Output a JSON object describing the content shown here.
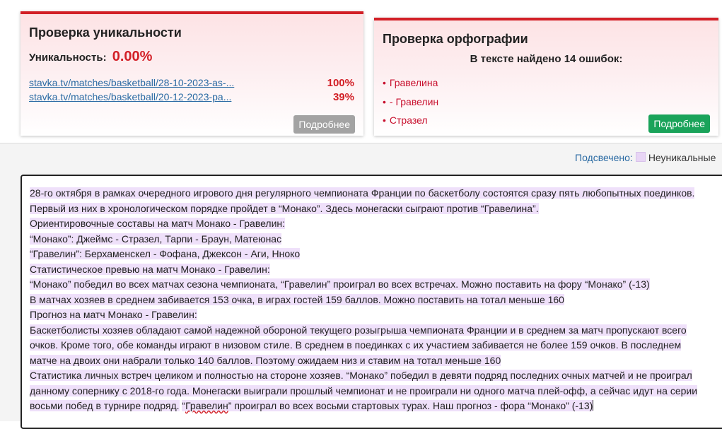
{
  "uniqueness_card": {
    "title": "Проверка уникальности",
    "uniqueness_label": "Уникальность:",
    "uniqueness_value": "0.00%",
    "sources": [
      {
        "url": "stavka.tv/matches/basketball/28-10-2023-as-...",
        "percent": "100%"
      },
      {
        "url": "stavka.tv/matches/basketball/20-12-2023-pa...",
        "percent": "39%"
      }
    ],
    "more_button": "Подробнее"
  },
  "spelling_card": {
    "title": "Проверка орфографии",
    "errors_found": "В тексте найдено 14 ошибок:",
    "errors": [
      "Гравелина",
      "- Гравелин",
      "Стразел"
    ],
    "bullet": "•",
    "more_button": "Подробнее"
  },
  "legend": {
    "label": "Подсвечено:",
    "item": "Неуникальные"
  },
  "editor": {
    "lines": [
      "28-го октября в рамках очередного игрового дня регулярного чемпионата Франции по баскетболу состоятся сразу пять любопытных поединков.",
      "Первый из них в хронологическом порядке пройдет в “Монако”. Здесь монегаски сыграют против “Гравелина”.",
      "Ориентировочные составы на матч Монако - Гравелин:",
      "“Монако”: Джеймс - Стразел, Тарпи - Браун, Матеюнас",
      "“Гравелин”: Берхаменскел - Фофана, Джексон - Аги, Нноко",
      "Статистическое превью на матч Монако - Гравелин:",
      "“Монако” победил во всех матчах сезона чемпионата, “Гравелин” проиграл во всех встречах. Можно поставить на фору “Монако” (-13)",
      "В матчах хозяев в среднем забивается 153 очка, в играх гостей 159 баллов. Можно поставить на тотал меньше 160",
      "Прогноз на матч Монако - Гравелин:",
      "Баскетболисты хозяев обладают самой надежной обороной текущего розыгрыша чемпионата Франции и в среднем за матч пропускают всего",
      "очков. Кроме того, обе команды играют в низовом стиле. В среднем в поединках с их участием забивается не более 159 очков. В последнем",
      "матче на двоих они набрали только 140 баллов. Поэтому ожидаем низ и ставим на тотал меньше 160",
      "Статистика личных встреч целиком и полностью на стороне хозяев. “Монако” победил в девяти подряд последних очных матчей и не проиграл",
      "данному сопернику с 2018-го года. Монегаски выиграли прошлый чемпионат и не проиграли ни одного матча плей-офф, а сейчас идут на серии",
      "восьми побед в турнире подряд."
    ],
    "last_line_parts": {
      "before": "“",
      "misspelled": "Гравелин",
      "after": "” проиграл во всех восьми стартовых турах. Наш прогноз - фора “Монако” (-13)"
    }
  },
  "colors": {
    "accent_red": "#d21f26",
    "link_blue": "#2a6aa3",
    "green_button": "#1aa35a",
    "grey_button": "#a3a3a3",
    "highlight": "#efe0fa"
  }
}
